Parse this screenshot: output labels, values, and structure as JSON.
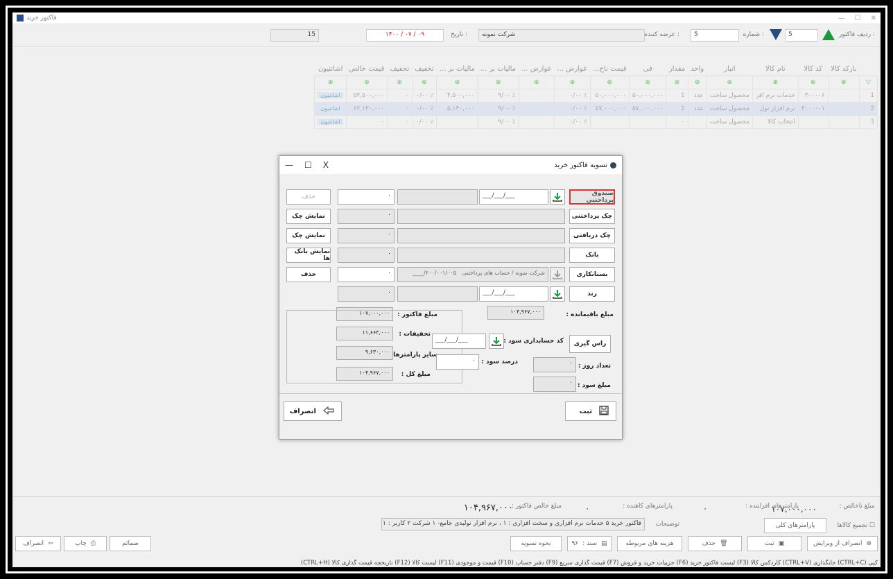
{
  "window": {
    "title": "فاکتور خرید"
  },
  "header": {
    "row_label": "ردیف فاکتور :",
    "row_value": "5",
    "number_label": "شماره :",
    "number_value": "5",
    "supplier_label": "عرضه کننده :",
    "supplier_value": "شرکت نمونه",
    "date_label": "تاریخ :",
    "date_value": "۱۴۰۰ / ۰۷ / ۰۹",
    "left_value": "15"
  },
  "grid": {
    "columns": [
      "بارکد کالا",
      "کد کالا",
      "نام کالا",
      "انبار",
      "واحد",
      "مقدار",
      "فی",
      "قیمت ناخ...",
      "عوارض ...",
      "عوارض ...",
      "مالیات بر ...",
      "مالیات بر ...",
      "تخفیف",
      "تخفیف",
      "قیمت خالص",
      "اشانتیون"
    ],
    "rows": [
      {
        "num": "1",
        "cells": [
          "",
          "۳۰۰۰۰۶",
          "خدمات نرم افز",
          "محصول ساخت",
          "عدد",
          "1",
          "۵۰,۰۰۰,۰۰۰",
          "۵۰,۰۰۰,۰۰۰",
          "٪ ۰/۰۰",
          "",
          "٪ ۹/۰۰",
          "۴,۵۰۰,۰۰۰",
          "٪ ۰/۰۰",
          "۰",
          "۵۴,۵۰۰,۰۰۰",
          "اشانتیون"
        ]
      },
      {
        "num": "2",
        "cells": [
          "",
          "۴۰۰۰۰۰۱",
          "نرم افزار تول",
          "محصول ساخت",
          "عدد",
          "1",
          "۵۷,۰۰۰,۰۰۰",
          "۵۷,۰۰۰,۰۰۰",
          "٪ ۰/۰۰",
          "",
          "٪ ۹/۰۰",
          "۵,۱۳۰,۰۰۰",
          "٪ ۰/۰۰",
          "۰",
          "۶۲,۱۳۰,۰۰۰",
          "اشانتیون"
        ]
      },
      {
        "num": "3",
        "cells": [
          "",
          "",
          "انتخاب کالا",
          "محصول ساخت",
          "",
          "۰",
          "",
          "",
          "٪ ۰/۰۰",
          "",
          "٪ ۹/۰۰",
          "",
          "٪ ۰/۰۰",
          "۰",
          "۰",
          "اشانتیون"
        ]
      }
    ]
  },
  "dialog": {
    "title": "تسویه فاکتور خرید",
    "buttons": {
      "cash": "صندوق پرداختنی",
      "check_payable": "چک پرداختنی",
      "check_receivable": "چک دریافتی",
      "bank": "بانک",
      "creditor": "بستانکاری",
      "round": "رند",
      "ras_giri": "راس گیری"
    },
    "date_placeholder": "___/___/___",
    "creditor_desc": "شرکت نمونه / حساب های پرداختنی",
    "creditor_code": "۲۰۰/۰۰۱/۰۰۵/____",
    "amounts": [
      "۰",
      "۰",
      "۰",
      "۰",
      "۰",
      "۰"
    ],
    "side_buttons": [
      "حذف",
      "نمایش چک",
      "نمایش چک",
      "نمایش بانک ها",
      "حذف"
    ],
    "remaining_label": "مبلغ باقیمانده :",
    "remaining_value": "۱۰۴,۹۶۷,۰۰۰",
    "invoice_amount_label": "مبلغ فاکتور :",
    "invoice_amount_value": "۱۰۷,۰۰۰,۰۰۰",
    "discounts_label": "تخفیفات :",
    "discounts_value": "۱۱,۶۶۳,۰۰۰",
    "other_params_label": "سایر پارامترها :",
    "other_params_value": "۹,۶۳۰,۰۰۰",
    "total_label": "مبلغ کل :",
    "total_value": "۱۰۴,۹۶۷,۰۰۰",
    "profit_code_label": "کد حسابداری سود :",
    "profit_percent_label": "درصد سود :",
    "profit_percent_value": "۰",
    "days_label": "تعداد روز :",
    "days_value": "۰",
    "profit_amount_label": "مبلغ سود :",
    "profit_amount_value": "۰",
    "save_label": "ثبت",
    "cancel_label": "انصراف",
    "close": "X",
    "maximize": "☐",
    "minimize": "—"
  },
  "bottom": {
    "payable_label": "مبلغ ناخالص :",
    "payable_value": "۱۰۷,۰۰۰,۰۰۰",
    "increase_params_label": "پارامترهای افزاینده :",
    "increase_params_value": "۰",
    "decrease_params_label": "پارامترهای کاهنده :",
    "decrease_params_value": "۰",
    "net_label": "مبلغ خالص فاکتور :",
    "net_value": "۱۰۴,۹۶۷,۰۰۰",
    "aggregate_label": "تجمیع کالاها",
    "general_params": "پارامترهای کلی",
    "description_label": "توضیحات",
    "description_value": "فاکتور خرید ۵ خدمات نرم افزاری و سخت افزاری : ۱ ، نرم افزار تولیدی جامع- ۱ شرکت ۲ کاربر : ۱",
    "cancel_edit": "انصراف از ویرایش",
    "save": "ثبت",
    "delete": "حذف",
    "related_costs": "هزینه های مربوطه",
    "doc": "سند :",
    "doc_value": "۹۶",
    "settlement": "نحوه تسویه",
    "attachments": "ضمائم",
    "print": "چاپ",
    "cancel": "انصراف",
    "shortcuts": "کپی (CTRL+C) جابگذاری (CTRL+V) کاردکس کالا (F3) لیست فاکتور خرید (F6) جزییات خرید و فروش (F7) قیمت گذاری سریع (F9) دفتر حساب (F10) قیمت و موجودی (F11) لیست کالا (F12) تاریخچه قیمت گذاری کالا (CTRL+H)"
  }
}
